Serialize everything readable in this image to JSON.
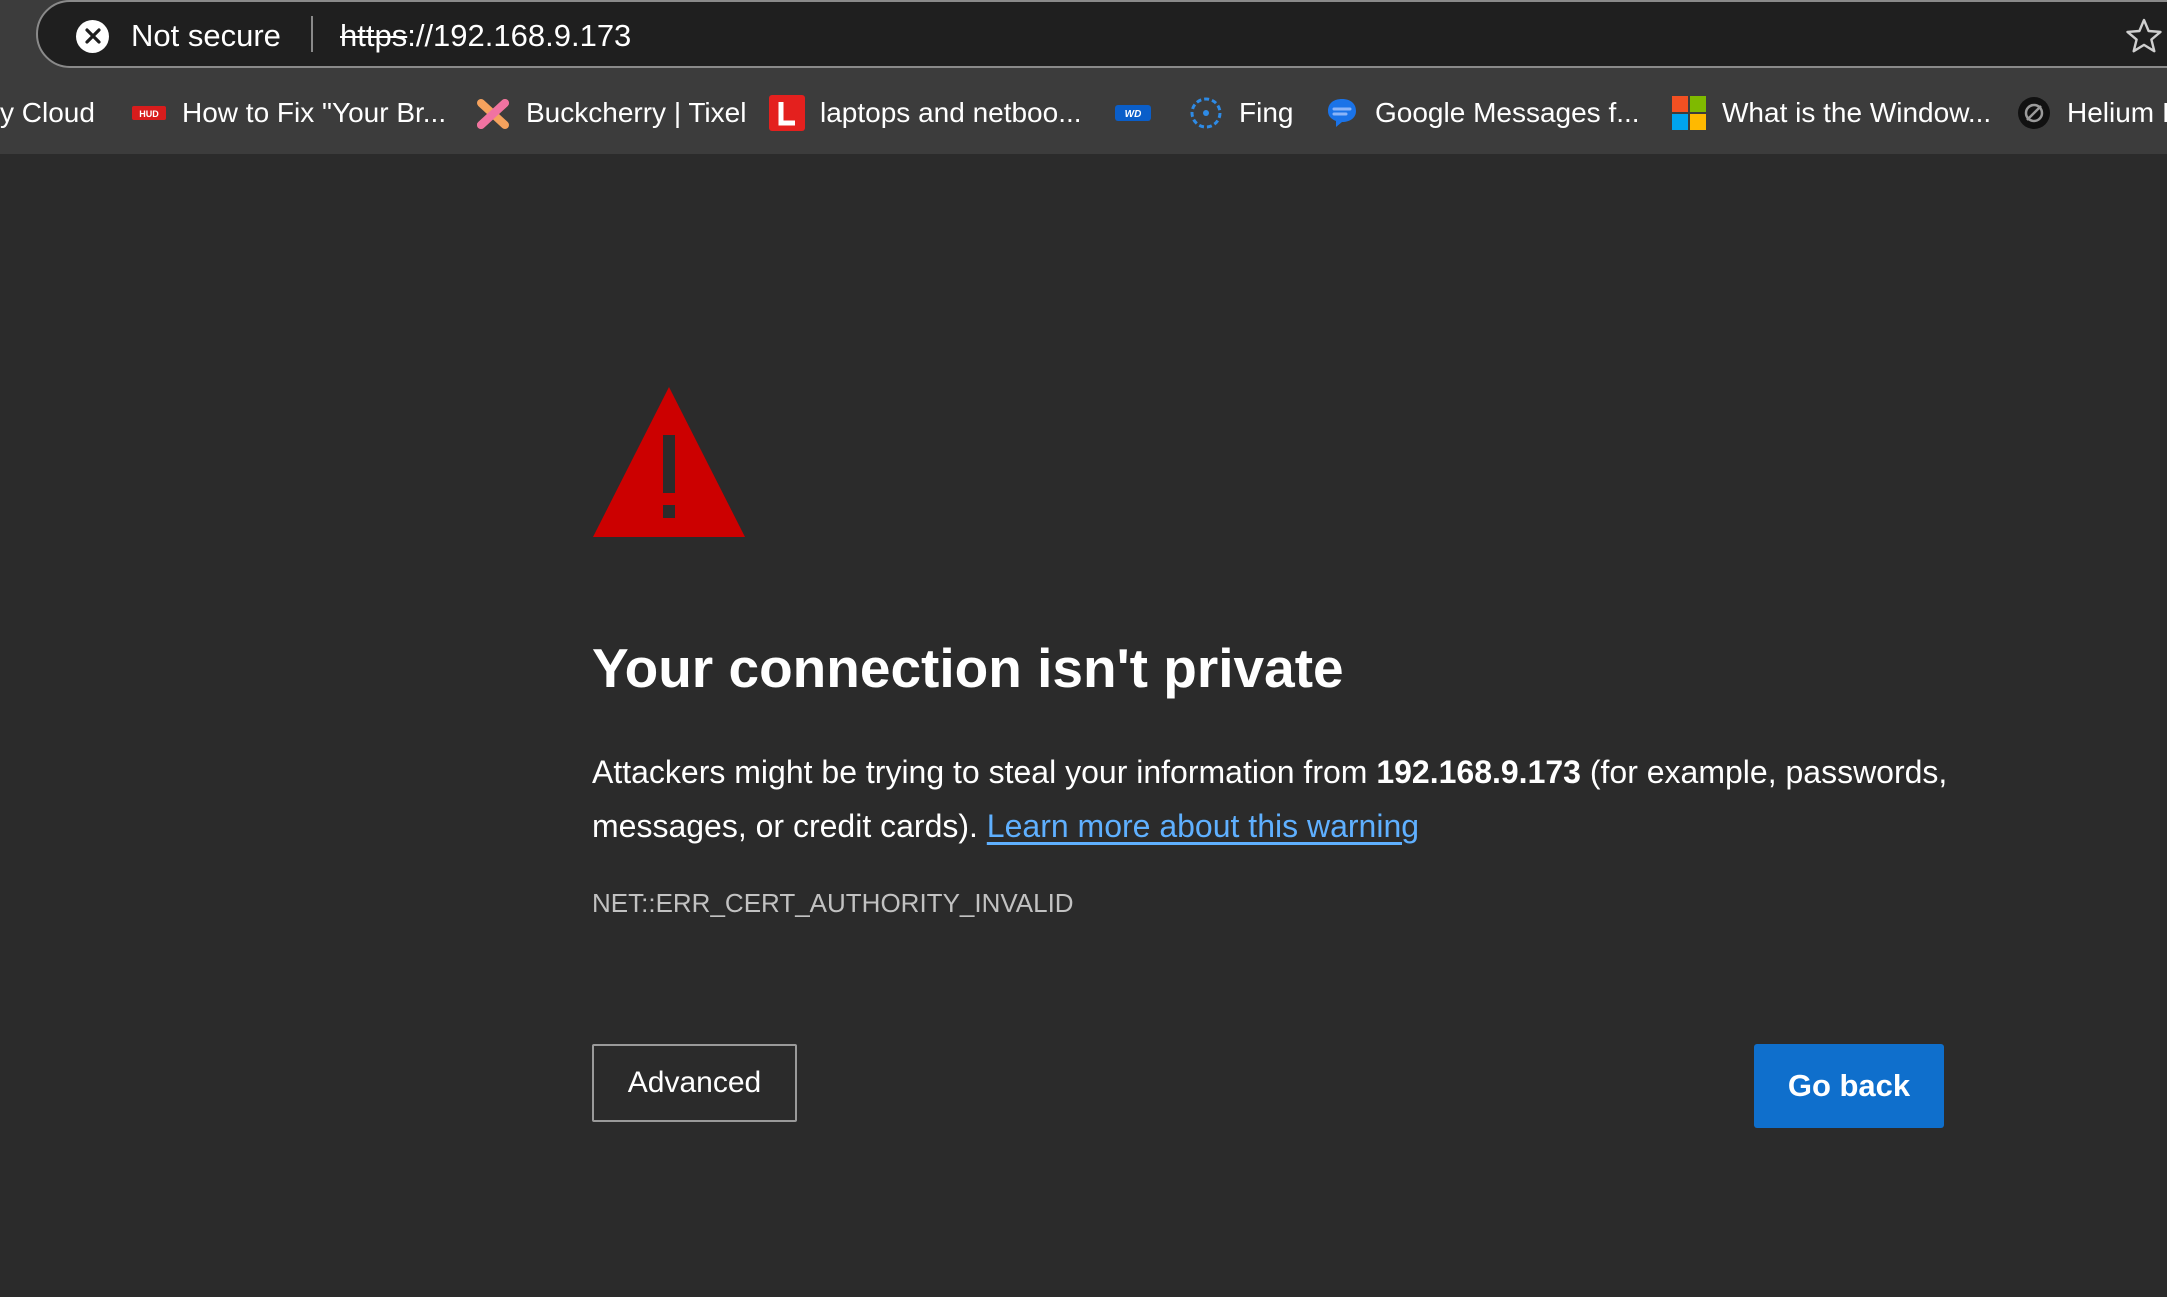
{
  "address_bar": {
    "security_label": "Not secure",
    "url_scheme": "https",
    "url_rest": "://192.168.9.173"
  },
  "bookmarks": [
    {
      "label": "y Cloud",
      "icon": "none"
    },
    {
      "label": "How to Fix \"Your Br...",
      "icon": "hud-icon"
    },
    {
      "label": "Buckcherry | Tixel",
      "icon": "tixel-icon"
    },
    {
      "label": "laptops and netboo...",
      "icon": "l-icon"
    },
    {
      "label": "",
      "icon": "wd-icon"
    },
    {
      "label": "Fing",
      "icon": "fing-icon"
    },
    {
      "label": "Google Messages f...",
      "icon": "messages-icon"
    },
    {
      "label": "What is the Window...",
      "icon": "microsoft-icon"
    },
    {
      "label": "Helium I",
      "icon": "helium-icon"
    }
  ],
  "page": {
    "title": "Your connection isn't private",
    "body_prefix": "Attackers might be trying to steal your information from ",
    "host": "192.168.9.173",
    "body_suffix": " (for example, passwords, messages, or credit cards). ",
    "learn_more": "Learn more about this warning",
    "error_code": "NET::ERR_CERT_AUTHORITY_INVALID",
    "advanced_label": "Advanced",
    "go_back_label": "Go back"
  },
  "colors": {
    "warning_red": "#cc0000",
    "link_blue": "#5fb0ff",
    "primary_button": "#0f6fcc",
    "background": "#2b2b2b"
  }
}
